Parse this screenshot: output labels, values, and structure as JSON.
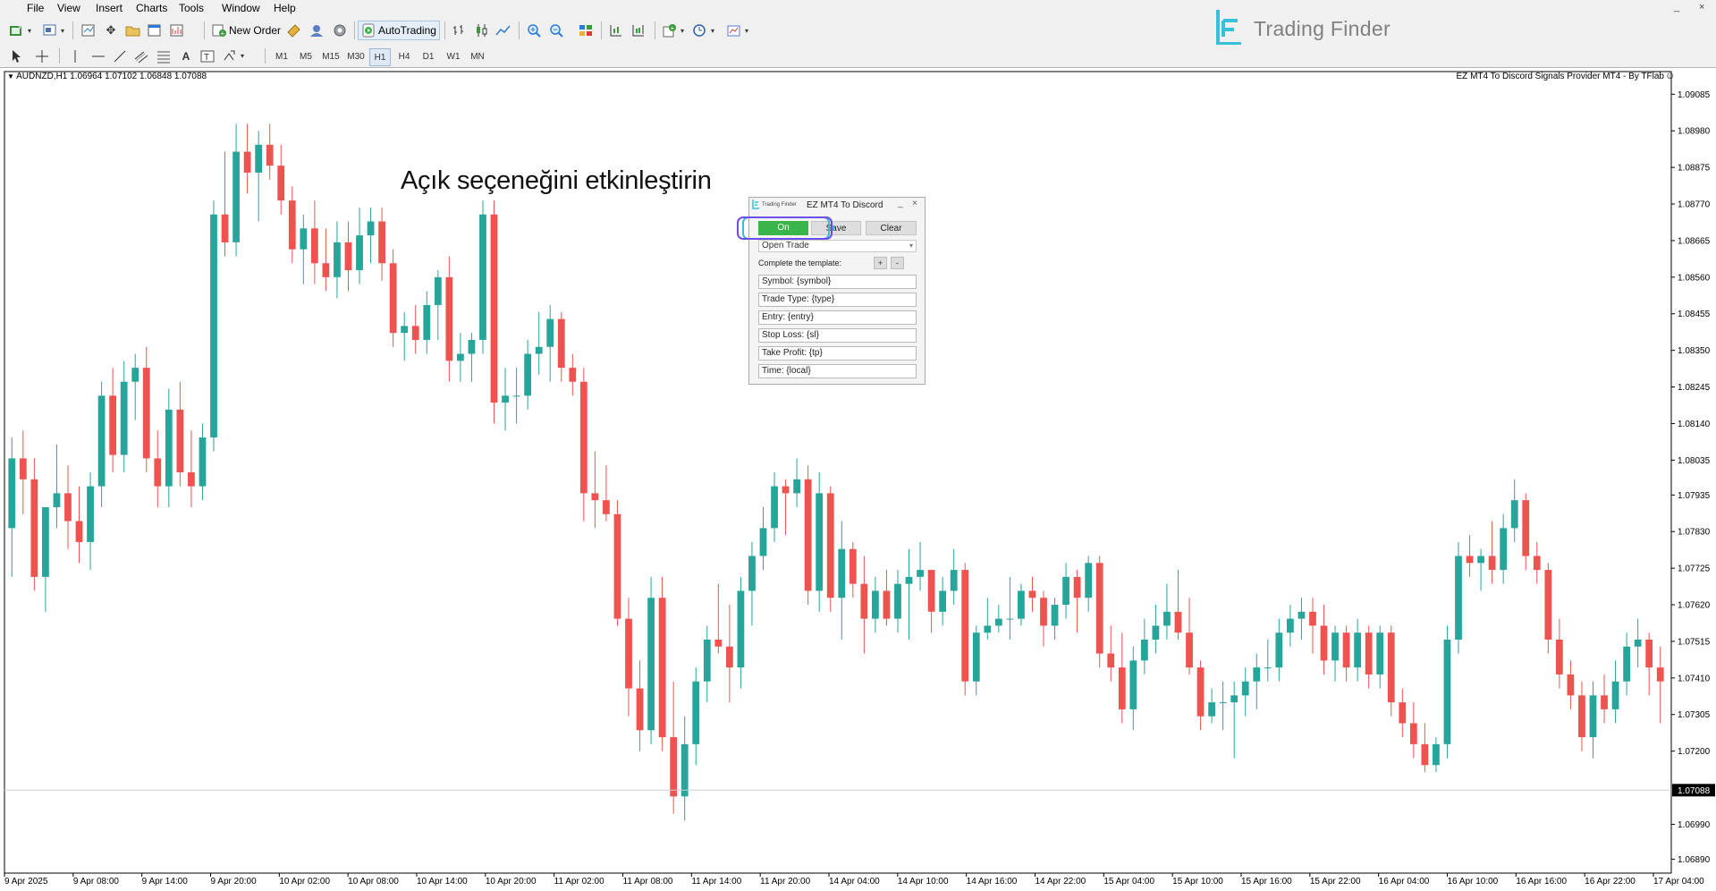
{
  "menu": [
    "File",
    "View",
    "Insert",
    "Charts",
    "Tools",
    "Window",
    "Help"
  ],
  "toolbar": {
    "new_order": "New Order",
    "autotrading": "AutoTrading"
  },
  "timeframes": [
    "M1",
    "M5",
    "M15",
    "M30",
    "H1",
    "H4",
    "D1",
    "W1",
    "MN"
  ],
  "active_timeframe": "H1",
  "brand": {
    "name": "Trading Finder",
    "accent": "#36c1d9"
  },
  "chart": {
    "symbol_info": "AUDNZD,H1  1.06964 1.07102 1.06848 1.07088",
    "ea_label": "EZ MT4 To Discord Signals Provider MT4 - By TFlab",
    "annotation": "Açık seçeneğini etkinleştirin",
    "current_price": "1.07088"
  },
  "panel": {
    "logo_text": "Trading Finder",
    "title": "EZ MT4 To Discord",
    "min_glyph": "_",
    "close_glyph": "×",
    "on_label": "On",
    "save_label": "Save",
    "clear_label": "Clear",
    "trade_type": "Open Trade",
    "select_arrow": "▾",
    "template_label": "Complete the template:",
    "plus": "+",
    "minus": "-",
    "fields": [
      "Symbol: {symbol}",
      "Trade Type: {type}",
      "Entry: {entry}",
      "Stop Loss: {sl}",
      "Take Profit: {tp}",
      "Time: {local}"
    ]
  },
  "colors": {
    "bull": "#26a69a",
    "bear": "#ef5350",
    "on_button": "#39b54a",
    "highlight": "#6b4de8"
  },
  "chart_data": {
    "type": "candlestick",
    "symbol": "AUDNZD",
    "timeframe": "H1",
    "ylim": [
      1.0685,
      1.0915
    ],
    "y_ticks": [
      "1.09085",
      "1.08980",
      "1.08875",
      "1.08770",
      "1.08665",
      "1.08560",
      "1.08455",
      "1.08350",
      "1.08245",
      "1.08140",
      "1.08035",
      "1.07935",
      "1.07830",
      "1.07725",
      "1.07620",
      "1.07515",
      "1.07410",
      "1.07305",
      "1.07200",
      "1.06990",
      "1.06890"
    ],
    "x_labels": [
      "9 Apr 2025",
      "9 Apr 08:00",
      "9 Apr 14:00",
      "9 Apr 20:00",
      "10 Apr 02:00",
      "10 Apr 08:00",
      "10 Apr 14:00",
      "10 Apr 20:00",
      "11 Apr 02:00",
      "11 Apr 08:00",
      "11 Apr 14:00",
      "11 Apr 20:00",
      "14 Apr 04:00",
      "14 Apr 10:00",
      "14 Apr 16:00",
      "14 Apr 22:00",
      "15 Apr 04:00",
      "15 Apr 10:00",
      "15 Apr 16:00",
      "15 Apr 22:00",
      "16 Apr 04:00",
      "16 Apr 10:00",
      "16 Apr 16:00",
      "16 Apr 22:00",
      "17 Apr 04:00"
    ],
    "candles": [
      [
        1.0784,
        1.081,
        1.077,
        1.0804
      ],
      [
        1.0804,
        1.0812,
        1.0788,
        1.0798
      ],
      [
        1.0798,
        1.0804,
        1.0766,
        1.077
      ],
      [
        1.077,
        1.0782,
        1.076,
        1.079
      ],
      [
        1.079,
        1.0808,
        1.0784,
        1.0794
      ],
      [
        1.0794,
        1.0802,
        1.0778,
        1.0786
      ],
      [
        1.0786,
        1.0796,
        1.0774,
        1.078
      ],
      [
        1.078,
        1.08,
        1.0772,
        1.0796
      ],
      [
        1.0796,
        1.0826,
        1.079,
        1.0822
      ],
      [
        1.0822,
        1.083,
        1.08,
        1.0805
      ],
      [
        1.0805,
        1.0832,
        1.08,
        1.0826
      ],
      [
        1.0826,
        1.0834,
        1.0815,
        1.083
      ],
      [
        1.083,
        1.0836,
        1.08,
        1.0804
      ],
      [
        1.0804,
        1.0812,
        1.079,
        1.0796
      ],
      [
        1.0796,
        1.0824,
        1.079,
        1.0818
      ],
      [
        1.0818,
        1.0826,
        1.0796,
        1.08
      ],
      [
        1.08,
        1.0812,
        1.079,
        1.0796
      ],
      [
        1.0796,
        1.0814,
        1.0792,
        1.081
      ],
      [
        1.081,
        1.0878,
        1.0806,
        1.0874
      ],
      [
        1.0874,
        1.0892,
        1.0862,
        1.0866
      ],
      [
        1.0866,
        1.09,
        1.0862,
        1.0892
      ],
      [
        1.0892,
        1.09,
        1.088,
        1.0886
      ],
      [
        1.0886,
        1.0898,
        1.0872,
        1.0894
      ],
      [
        1.0894,
        1.09,
        1.0884,
        1.0888
      ],
      [
        1.0888,
        1.0894,
        1.0874,
        1.0878
      ],
      [
        1.0878,
        1.0882,
        1.086,
        1.0864
      ],
      [
        1.0864,
        1.0874,
        1.0854,
        1.087
      ],
      [
        1.087,
        1.0878,
        1.0854,
        1.086
      ],
      [
        1.086,
        1.087,
        1.0852,
        1.0856
      ],
      [
        1.0856,
        1.0872,
        1.085,
        1.0866
      ],
      [
        1.0866,
        1.0872,
        1.0852,
        1.0858
      ],
      [
        1.0858,
        1.0876,
        1.0854,
        1.0868
      ],
      [
        1.0868,
        1.0876,
        1.086,
        1.0872
      ],
      [
        1.0872,
        1.0876,
        1.0855,
        1.086
      ],
      [
        1.086,
        1.0864,
        1.0836,
        1.084
      ],
      [
        1.084,
        1.0846,
        1.0832,
        1.0842
      ],
      [
        1.0842,
        1.0848,
        1.0834,
        1.0838
      ],
      [
        1.0838,
        1.0852,
        1.0834,
        1.0848
      ],
      [
        1.0848,
        1.0858,
        1.0838,
        1.0856
      ],
      [
        1.0856,
        1.0862,
        1.0826,
        1.0832
      ],
      [
        1.0832,
        1.084,
        1.0826,
        1.0834
      ],
      [
        1.0834,
        1.084,
        1.0826,
        1.0838
      ],
      [
        1.0838,
        1.0878,
        1.0834,
        1.0874
      ],
      [
        1.0874,
        1.0878,
        1.0814,
        1.082
      ],
      [
        1.082,
        1.083,
        1.0812,
        1.0822
      ],
      [
        1.0822,
        1.083,
        1.0814,
        1.0822
      ],
      [
        1.0822,
        1.0838,
        1.0818,
        1.0834
      ],
      [
        1.0834,
        1.0846,
        1.0828,
        1.0836
      ],
      [
        1.0836,
        1.0848,
        1.0826,
        1.0844
      ],
      [
        1.0844,
        1.0846,
        1.0826,
        1.083
      ],
      [
        1.083,
        1.0834,
        1.0822,
        1.0826
      ],
      [
        1.0826,
        1.083,
        1.0786,
        1.0794
      ],
      [
        1.0794,
        1.0806,
        1.0784,
        1.0792
      ],
      [
        1.0792,
        1.0802,
        1.0786,
        1.0788
      ],
      [
        1.0788,
        1.0792,
        1.0756,
        1.0758
      ],
      [
        1.0758,
        1.0764,
        1.073,
        1.0738
      ],
      [
        1.0738,
        1.0746,
        1.072,
        1.0726
      ],
      [
        1.0726,
        1.077,
        1.0722,
        1.0764
      ],
      [
        1.0764,
        1.077,
        1.072,
        1.0724
      ],
      [
        1.0724,
        1.074,
        1.0702,
        1.0707
      ],
      [
        1.0707,
        1.073,
        1.07,
        1.0722
      ],
      [
        1.0722,
        1.0744,
        1.0716,
        1.074
      ],
      [
        1.074,
        1.0756,
        1.0734,
        1.0752
      ],
      [
        1.0752,
        1.0768,
        1.0748,
        1.075
      ],
      [
        1.075,
        1.0762,
        1.0734,
        1.0744
      ],
      [
        1.0744,
        1.077,
        1.0738,
        1.0766
      ],
      [
        1.0766,
        1.078,
        1.0756,
        1.0776
      ],
      [
        1.0776,
        1.079,
        1.0772,
        1.0784
      ],
      [
        1.0784,
        1.08,
        1.078,
        1.0796
      ],
      [
        1.0796,
        1.0798,
        1.0782,
        1.0794
      ],
      [
        1.0794,
        1.0804,
        1.079,
        1.0798
      ],
      [
        1.0798,
        1.0802,
        1.0762,
        1.0766
      ],
      [
        1.0766,
        1.08,
        1.076,
        1.0794
      ],
      [
        1.0794,
        1.0796,
        1.076,
        1.0764
      ],
      [
        1.0764,
        1.0786,
        1.0752,
        1.0778
      ],
      [
        1.0778,
        1.078,
        1.0764,
        1.0768
      ],
      [
        1.0768,
        1.0776,
        1.0748,
        1.0758
      ],
      [
        1.0758,
        1.077,
        1.0754,
        1.0766
      ],
      [
        1.0766,
        1.0772,
        1.0756,
        1.0758
      ],
      [
        1.0758,
        1.0772,
        1.0754,
        1.0768
      ],
      [
        1.0768,
        1.0778,
        1.0752,
        1.077
      ],
      [
        1.077,
        1.078,
        1.0766,
        1.0772
      ],
      [
        1.0772,
        1.0772,
        1.0754,
        1.076
      ],
      [
        1.076,
        1.077,
        1.0756,
        1.0766
      ],
      [
        1.0766,
        1.0778,
        1.0762,
        1.0772
      ],
      [
        1.0772,
        1.0774,
        1.0736,
        1.074
      ],
      [
        1.074,
        1.0756,
        1.0736,
        1.0754
      ],
      [
        1.0754,
        1.0764,
        1.0752,
        1.0756
      ],
      [
        1.0756,
        1.0762,
        1.0754,
        1.0758
      ],
      [
        1.0758,
        1.077,
        1.0752,
        1.0758
      ],
      [
        1.0758,
        1.0768,
        1.0756,
        1.0766
      ],
      [
        1.0766,
        1.077,
        1.076,
        1.0764
      ],
      [
        1.0764,
        1.0766,
        1.075,
        1.0756
      ],
      [
        1.0756,
        1.0764,
        1.0752,
        1.0762
      ],
      [
        1.0762,
        1.0774,
        1.0758,
        1.077
      ],
      [
        1.077,
        1.0772,
        1.0754,
        1.0764
      ],
      [
        1.0764,
        1.0776,
        1.076,
        1.0774
      ],
      [
        1.0774,
        1.0776,
        1.0744,
        1.0748
      ],
      [
        1.0748,
        1.0756,
        1.074,
        1.0744
      ],
      [
        1.0744,
        1.0754,
        1.0728,
        1.0732
      ],
      [
        1.0732,
        1.075,
        1.0726,
        1.0746
      ],
      [
        1.0746,
        1.0758,
        1.0742,
        1.0752
      ],
      [
        1.0752,
        1.0762,
        1.0748,
        1.0756
      ],
      [
        1.0756,
        1.0768,
        1.0752,
        1.076
      ],
      [
        1.076,
        1.0772,
        1.0752,
        1.0754
      ],
      [
        1.0754,
        1.0764,
        1.0742,
        1.0744
      ],
      [
        1.0744,
        1.0746,
        1.0726,
        1.073
      ],
      [
        1.073,
        1.0738,
        1.0728,
        1.0734
      ],
      [
        1.0734,
        1.074,
        1.0726,
        1.0734
      ],
      [
        1.0734,
        1.074,
        1.0718,
        1.0736
      ],
      [
        1.0736,
        1.0744,
        1.073,
        1.074
      ],
      [
        1.074,
        1.0748,
        1.0732,
        1.0744
      ],
      [
        1.0744,
        1.0752,
        1.074,
        1.0744
      ],
      [
        1.0744,
        1.0758,
        1.074,
        1.0754
      ],
      [
        1.0754,
        1.0762,
        1.075,
        1.0758
      ],
      [
        1.0758,
        1.0764,
        1.0752,
        1.076
      ],
      [
        1.076,
        1.0764,
        1.0748,
        1.0756
      ],
      [
        1.0756,
        1.0762,
        1.0742,
        1.0746
      ],
      [
        1.0746,
        1.0756,
        1.074,
        1.0754
      ],
      [
        1.0754,
        1.0756,
        1.074,
        1.0744
      ],
      [
        1.0744,
        1.0758,
        1.074,
        1.0754
      ],
      [
        1.0754,
        1.0756,
        1.0738,
        1.0742
      ],
      [
        1.0742,
        1.0756,
        1.0738,
        1.0754
      ],
      [
        1.0754,
        1.0756,
        1.073,
        1.0734
      ],
      [
        1.0734,
        1.0738,
        1.0724,
        1.0728
      ],
      [
        1.0728,
        1.0734,
        1.0718,
        1.0722
      ],
      [
        1.0722,
        1.0728,
        1.0714,
        1.0716
      ],
      [
        1.0716,
        1.0724,
        1.0714,
        1.0722
      ],
      [
        1.0722,
        1.0756,
        1.0718,
        1.0752
      ],
      [
        1.0752,
        1.078,
        1.0748,
        1.0776
      ],
      [
        1.0776,
        1.0782,
        1.077,
        1.0774
      ],
      [
        1.0774,
        1.0778,
        1.0766,
        1.0776
      ],
      [
        1.0776,
        1.0786,
        1.0768,
        1.0772
      ],
      [
        1.0772,
        1.0788,
        1.0768,
        1.0784
      ],
      [
        1.0784,
        1.0798,
        1.078,
        1.0792
      ],
      [
        1.0792,
        1.0794,
        1.0772,
        1.0776
      ],
      [
        1.0776,
        1.078,
        1.0768,
        1.0772
      ],
      [
        1.0772,
        1.0774,
        1.0748,
        1.0752
      ],
      [
        1.0752,
        1.0758,
        1.0738,
        1.0742
      ],
      [
        1.0742,
        1.0746,
        1.0732,
        1.0736
      ],
      [
        1.0736,
        1.074,
        1.072,
        1.0724
      ],
      [
        1.0724,
        1.074,
        1.0718,
        1.0736
      ],
      [
        1.0736,
        1.0742,
        1.0728,
        1.0732
      ],
      [
        1.0732,
        1.0746,
        1.0728,
        1.074
      ],
      [
        1.074,
        1.0754,
        1.0736,
        1.075
      ],
      [
        1.075,
        1.0758,
        1.0744,
        1.0752
      ],
      [
        1.0752,
        1.0754,
        1.0736,
        1.0744
      ],
      [
        1.0744,
        1.075,
        1.0728,
        1.074
      ]
    ]
  }
}
